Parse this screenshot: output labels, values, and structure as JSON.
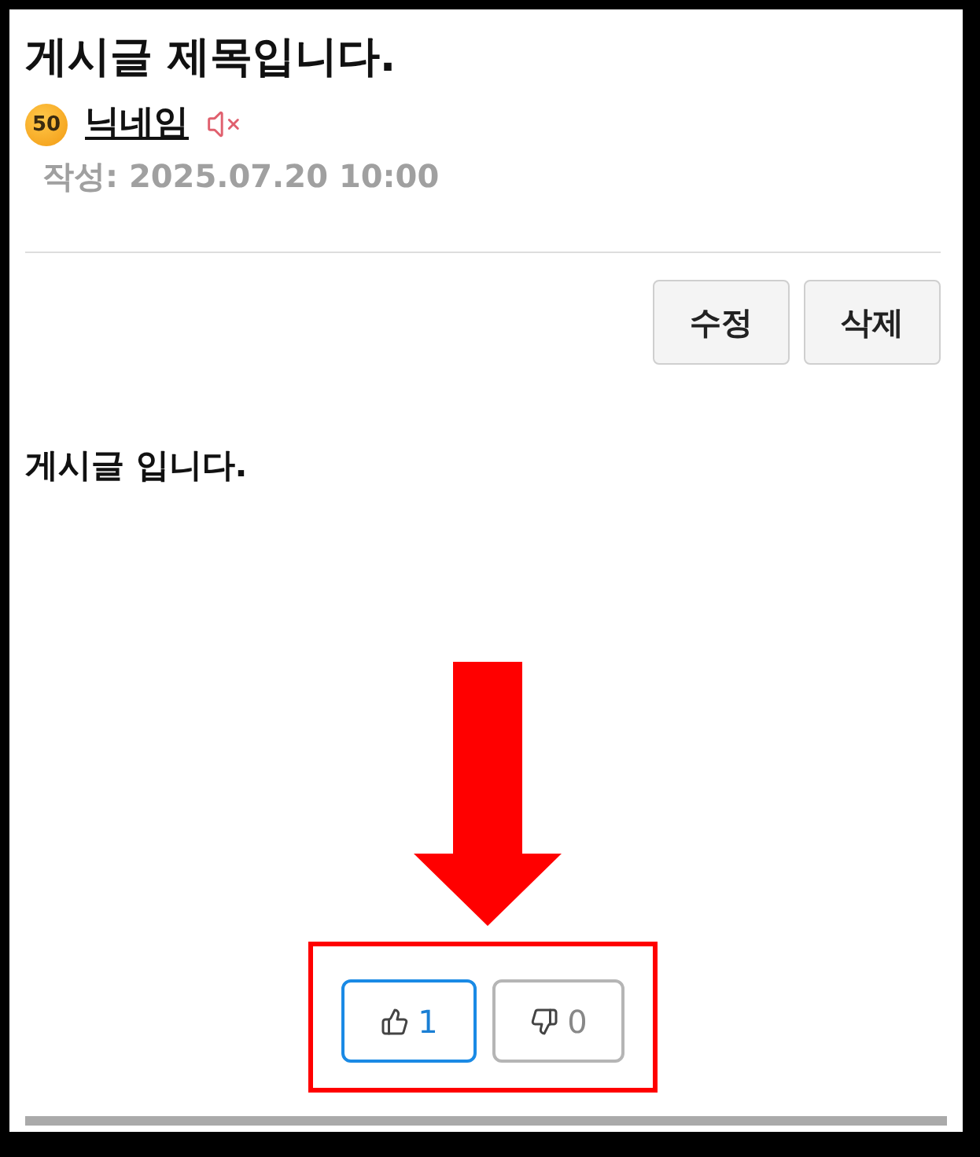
{
  "post": {
    "title": "게시글 제목입니다.",
    "author": {
      "level": "50",
      "nickname": "닉네임"
    },
    "date": "작성: 2025.07.20 10:00",
    "actions": [
      "수정",
      "삭제"
    ],
    "body": "게시글 입니다.",
    "votes": [
      {
        "kind": "like",
        "count": "1",
        "selected": true
      },
      {
        "kind": "dislike",
        "count": "0",
        "selected": false
      }
    ]
  }
}
